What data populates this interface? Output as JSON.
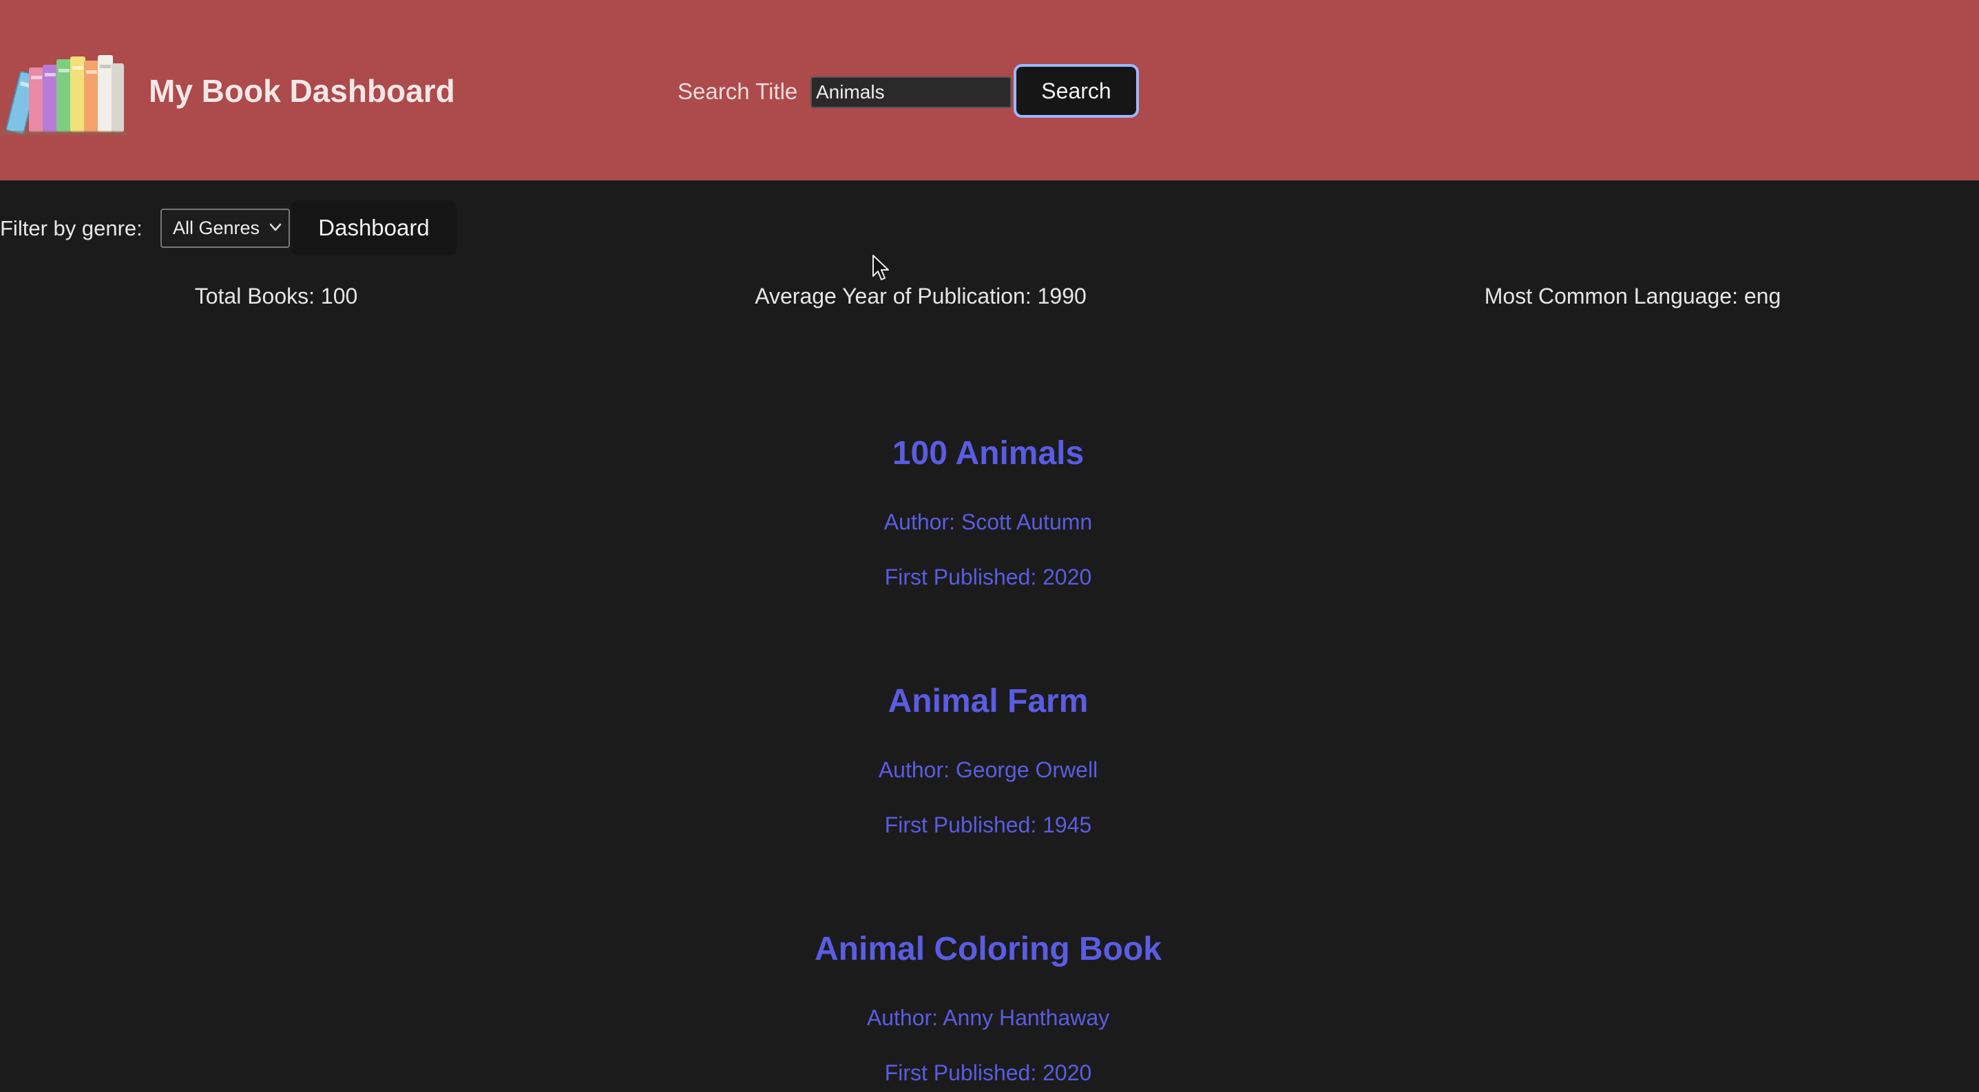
{
  "header": {
    "title": "My Book Dashboard",
    "logo_icon": "books-icon",
    "search_label": "Search Title",
    "search_value": "Animals",
    "search_button": "Search",
    "colors": {
      "background": "#ad4a4b",
      "button_border": "#9bb8ff"
    }
  },
  "filter": {
    "label": "Filter by genre:",
    "selected_genre": "All Genres",
    "dashboard_button": "Dashboard"
  },
  "stats": {
    "total_books": "Total Books: 100",
    "average_year": "Average Year of Publication: 1990",
    "common_language": "Most Common Language: eng"
  },
  "books": [
    {
      "title": "100 Animals",
      "author": "Author: Scott Autumn",
      "published": "First Published: 2020"
    },
    {
      "title": "Animal Farm",
      "author": "Author: George Orwell",
      "published": "First Published: 1945"
    },
    {
      "title": "Animal Coloring Book",
      "author": "Author: Anny Hanthaway",
      "published": "First Published: 2020"
    }
  ],
  "colors": {
    "page_background": "#1b1b1b",
    "book_text": "#5a5ce3"
  }
}
